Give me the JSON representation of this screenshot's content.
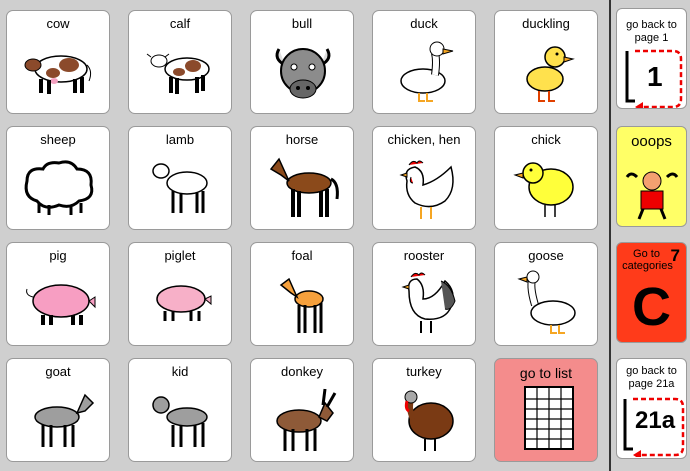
{
  "cells": [
    {
      "label": "cow",
      "icon": "cow-icon"
    },
    {
      "label": "calf",
      "icon": "calf-icon"
    },
    {
      "label": "bull",
      "icon": "bull-icon"
    },
    {
      "label": "duck",
      "icon": "duck-icon"
    },
    {
      "label": "duckling",
      "icon": "duckling-icon"
    },
    {
      "label": "sheep",
      "icon": "sheep-icon"
    },
    {
      "label": "lamb",
      "icon": "lamb-icon"
    },
    {
      "label": "horse",
      "icon": "horse-icon"
    },
    {
      "label": "chicken,  hen",
      "icon": "hen-icon"
    },
    {
      "label": "chick",
      "icon": "chick-icon"
    },
    {
      "label": "pig",
      "icon": "pig-icon"
    },
    {
      "label": "piglet",
      "icon": "piglet-icon"
    },
    {
      "label": "foal",
      "icon": "foal-icon"
    },
    {
      "label": "rooster",
      "icon": "rooster-icon"
    },
    {
      "label": "goose",
      "icon": "goose-icon"
    },
    {
      "label": "goat",
      "icon": "goat-icon"
    },
    {
      "label": "kid",
      "icon": "kid-goat-icon"
    },
    {
      "label": "donkey",
      "icon": "donkey-icon"
    },
    {
      "label": "turkey",
      "icon": "turkey-icon"
    },
    {
      "label": "go to list",
      "icon": "list-icon"
    }
  ],
  "sidebar": {
    "back1": {
      "line1": "go back to",
      "line2": "page 1",
      "number": "1"
    },
    "ooops": {
      "label": "ooops"
    },
    "categories": {
      "line1": "Go to",
      "line2": "categories",
      "number": "7",
      "letter": "C"
    },
    "back21": {
      "line1": "go back to",
      "line2": "page 21a",
      "number": "21a"
    }
  },
  "colors": {
    "list_bg": "#f48c8c",
    "ooops_bg": "#ffff66",
    "categories_bg": "#ff3b1a",
    "page_bg": "#cfcfcf"
  }
}
